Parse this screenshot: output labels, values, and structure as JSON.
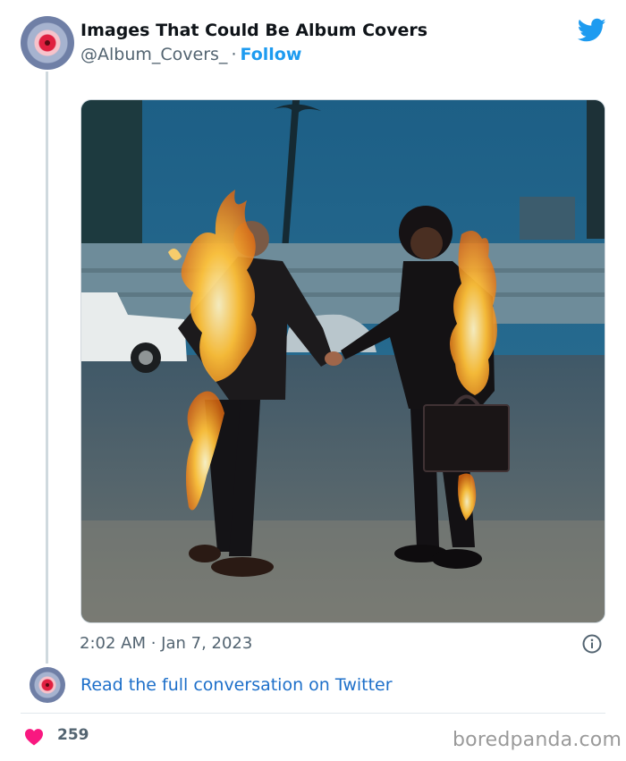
{
  "tweet": {
    "author_name": "Images That Could Be Album Covers",
    "handle": "@Album_Covers_",
    "separator": "·",
    "follow_label": "Follow",
    "timestamp": "2:02 AM · Jan 7, 2023",
    "read_more_label": "Read the full conversation on Twitter",
    "like_count": "259"
  },
  "icons": {
    "twitter_logo": "twitter-bird-icon",
    "info": "info-icon",
    "heart": "heart-icon"
  },
  "footer": {
    "watermark": "boredpanda.com"
  },
  "colors": {
    "accent": "#1d9bf0",
    "link": "#1d6fc9",
    "heart": "#f91880",
    "secondary_text": "#536471"
  }
}
